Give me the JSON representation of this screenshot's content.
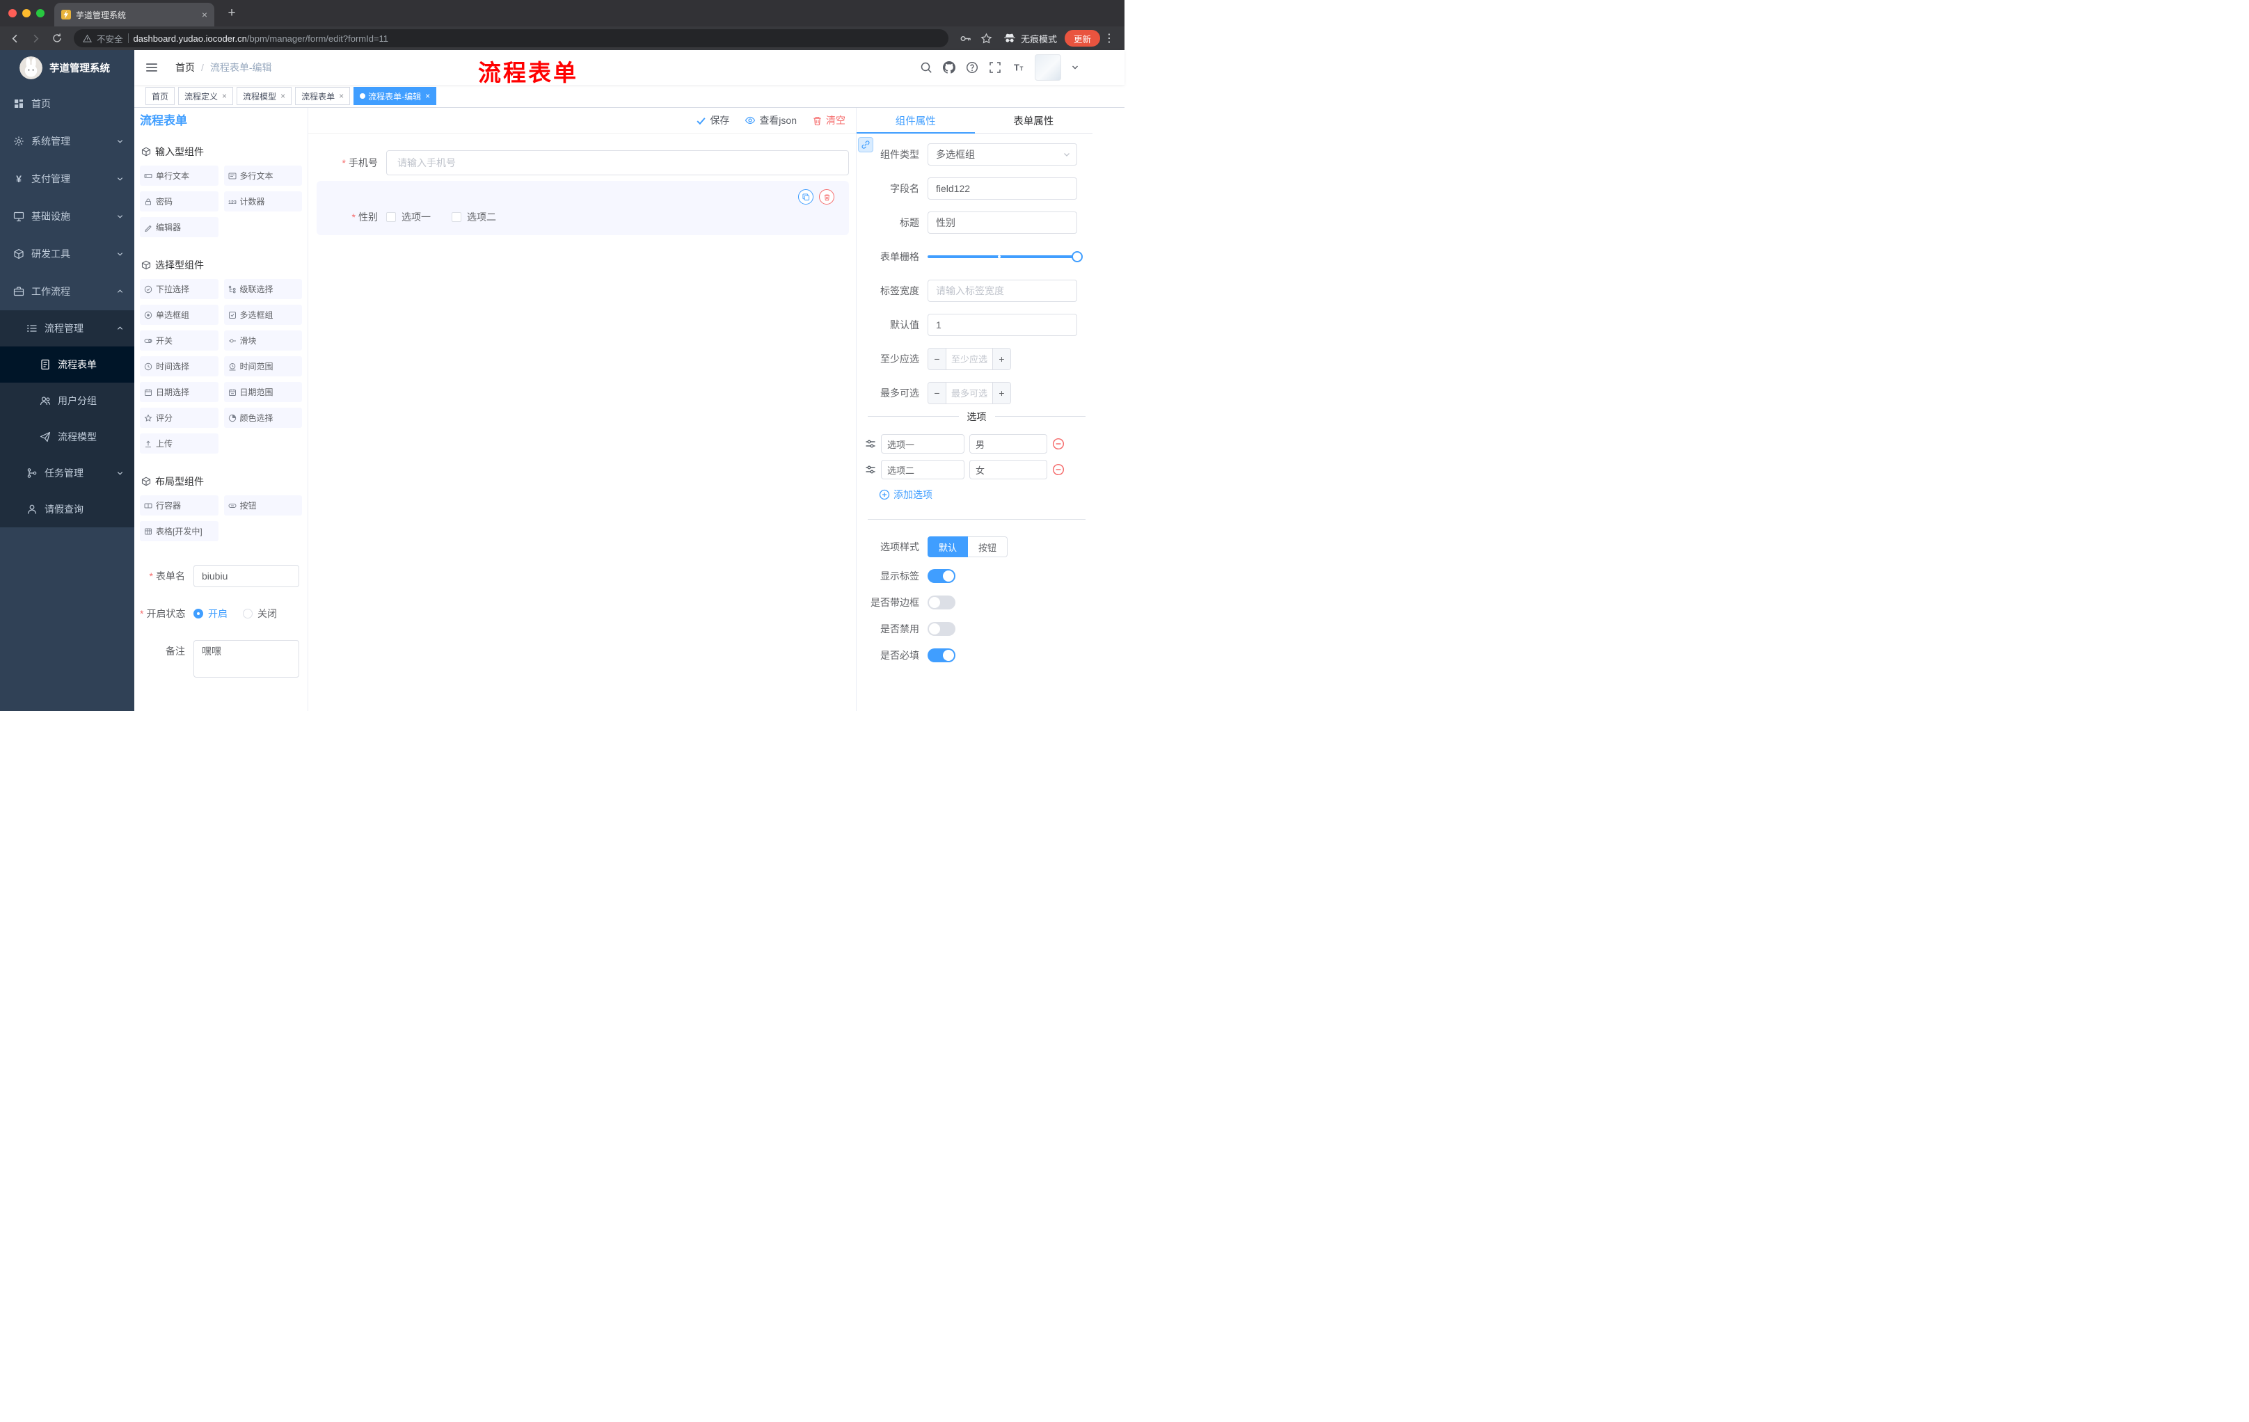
{
  "colors": {
    "accent": "#409eff",
    "danger": "#f56c6c",
    "annotation_red": "#ff0000",
    "sidebar_bg": "#304156",
    "sidebar_sub_bg": "#1f2d3d",
    "active_tag_bg": "#409eff",
    "update_button_bg": "#e9543f",
    "selected_item_bg": "#f6f7ff"
  },
  "browser": {
    "tab_title": "芋道管理系统",
    "security_label": "不安全",
    "url_domain": "dashboard.yudao.iocoder.cn",
    "url_path": "/bpm/manager/form/edit?formId=11",
    "incognito_label": "无痕模式",
    "update_label": "更新"
  },
  "sidebar": {
    "logo_title": "芋道管理系统",
    "items": [
      {
        "label": "首页",
        "icon": "dashboard-icon"
      },
      {
        "label": "系统管理",
        "icon": "gear-icon"
      },
      {
        "label": "支付管理",
        "icon": "yen-icon"
      },
      {
        "label": "基础设施",
        "icon": "monitor-icon"
      },
      {
        "label": "研发工具",
        "icon": "cube-icon"
      },
      {
        "label": "工作流程",
        "icon": "briefcase-icon"
      },
      {
        "label": "流程管理",
        "icon": "list-icon"
      },
      {
        "label": "流程表单",
        "icon": "document-icon"
      },
      {
        "label": "用户分组",
        "icon": "users-icon"
      },
      {
        "label": "流程模型",
        "icon": "send-icon"
      },
      {
        "label": "任务管理",
        "icon": "branch-icon"
      },
      {
        "label": "请假查询",
        "icon": "user-icon"
      }
    ]
  },
  "header": {
    "breadcrumb_root": "首页",
    "breadcrumb_separator": "/",
    "breadcrumb_current": "流程表单-编辑",
    "annotation": "流程表单"
  },
  "tags": {
    "items": [
      {
        "label": "首页"
      },
      {
        "label": "流程定义"
      },
      {
        "label": "流程模型"
      },
      {
        "label": "流程表单"
      },
      {
        "label": "流程表单-编辑"
      }
    ]
  },
  "designer": {
    "title": "流程表单",
    "actions": {
      "save": "保存",
      "view_json": "查看json",
      "clear": "清空"
    },
    "palette": {
      "sections": [
        {
          "title": "输入型组件",
          "items": [
            {
              "label": "单行文本",
              "icon": "input-icon"
            },
            {
              "label": "多行文本",
              "icon": "textarea-icon"
            },
            {
              "label": "密码",
              "icon": "lock-icon"
            },
            {
              "label": "计数器",
              "icon": "counter-icon"
            },
            {
              "label": "编辑器",
              "icon": "editor-icon"
            }
          ]
        },
        {
          "title": "选择型组件",
          "items": [
            {
              "label": "下拉选择",
              "icon": "select-icon"
            },
            {
              "label": "级联选择",
              "icon": "cascader-icon"
            },
            {
              "label": "单选框组",
              "icon": "radio-icon"
            },
            {
              "label": "多选框组",
              "icon": "checkbox-icon"
            },
            {
              "label": "开关",
              "icon": "switch-icon"
            },
            {
              "label": "滑块",
              "icon": "slider-icon"
            },
            {
              "label": "时间选择",
              "icon": "time-icon"
            },
            {
              "label": "时间范围",
              "icon": "time-range-icon"
            },
            {
              "label": "日期选择",
              "icon": "date-icon"
            },
            {
              "label": "日期范围",
              "icon": "date-range-icon"
            },
            {
              "label": "评分",
              "icon": "star-icon"
            },
            {
              "label": "颜色选择",
              "icon": "color-icon"
            },
            {
              "label": "上传",
              "icon": "upload-icon"
            }
          ]
        },
        {
          "title": "布局型组件",
          "items": [
            {
              "label": "行容器",
              "icon": "row-icon"
            },
            {
              "label": "按钮",
              "icon": "button-icon"
            },
            {
              "label": "表格[开发中]",
              "icon": "table-icon"
            }
          ]
        }
      ]
    },
    "meta": {
      "name_label": "表单名",
      "name_value": "biubiu",
      "status_label": "开启状态",
      "status_on": "开启",
      "status_off": "关闭",
      "remark_label": "备注",
      "remark_value": "嘿嘿"
    },
    "canvas": {
      "phone_label": "手机号",
      "phone_placeholder": "请输入手机号",
      "gender_label": "性别",
      "gender_option1": "选项一",
      "gender_option2": "选项二"
    }
  },
  "panel": {
    "tab_component": "组件属性",
    "tab_form": "表单属性",
    "rows": {
      "type_label": "组件类型",
      "type_value": "多选框组",
      "field_label": "字段名",
      "field_value": "field122",
      "title_label": "标题",
      "title_value": "性别",
      "grid_label": "表单栅格",
      "width_label": "标签宽度",
      "width_placeholder": "请输入标签宽度",
      "default_label": "默认值",
      "default_value": "1",
      "min_label": "至少应选",
      "min_placeholder": "至少应选",
      "max_label": "最多可选",
      "max_placeholder": "最多可选"
    },
    "options": {
      "divider_title": "选项",
      "row1_label": "选项一",
      "row1_value": "男",
      "row2_label": "选项二",
      "row2_value": "女",
      "add_label": "添加选项"
    },
    "style": {
      "option_style_label": "选项样式",
      "style_default": "默认",
      "style_button": "按钮",
      "show_label": "显示标签",
      "border_label": "是否带边框",
      "disabled_label": "是否禁用",
      "required_label": "是否必填"
    }
  }
}
